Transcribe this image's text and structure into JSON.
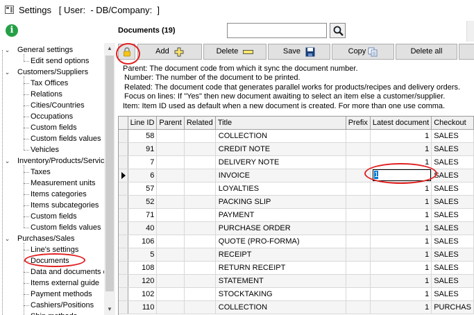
{
  "window": {
    "title": "Settings   [ User:  - DB/Company:  ]"
  },
  "tree": {
    "groups": [
      {
        "label": "General settings",
        "items": [
          "Edit send options"
        ]
      },
      {
        "label": "Customers/Suppliers",
        "items": [
          "Tax Offices",
          "Relations",
          "Cities/Countries",
          "Occupations",
          "Custom fields",
          "Custom fields values",
          "Vehicles"
        ]
      },
      {
        "label": "Inventory/Products/Servic",
        "items": [
          "Taxes",
          "Measurement units",
          "Items categories",
          "Items subcategories",
          "Custom fields",
          "Custom fields values"
        ]
      },
      {
        "label": "Purchases/Sales",
        "items": [
          "Line's settings",
          "Documents",
          "Data and documents c",
          "Items external guide",
          "Payment methods",
          "Cashiers/Positions",
          "Ship methods"
        ]
      }
    ]
  },
  "main": {
    "title": "Documents (19)",
    "search": {
      "value": "",
      "placeholder": ""
    },
    "toolbar": {
      "add": "Add",
      "delete": "Delete",
      "save": "Save",
      "copy": "Copy",
      "delete_all": "Delete all"
    },
    "notes": [
      "Parent: The document code from which it sync the document number.",
      "Number: The number of the document to be printed.",
      "Related: The document code that generates parallel works for products/recipes and delivery orders.",
      "Focus on lines: If \"Yes\" then new document awaiting to select an item else a customer/supplier.",
      "Item: Item ID used as default when a new document is created. For more than one use comma."
    ]
  },
  "grid": {
    "columns": [
      "Line ID",
      "Parent",
      "Related",
      "Title",
      "Prefix",
      "Latest document",
      "Checkout"
    ],
    "rows": [
      {
        "id": "58",
        "parent": "",
        "related": "",
        "title": "COLLECTION",
        "prefix": "",
        "latest": "1",
        "checkout": "SALES"
      },
      {
        "id": "91",
        "parent": "",
        "related": "",
        "title": "CREDIT NOTE",
        "prefix": "",
        "latest": "1",
        "checkout": "SALES"
      },
      {
        "id": "7",
        "parent": "",
        "related": "",
        "title": "DELIVERY NOTE",
        "prefix": "",
        "latest": "1",
        "checkout": "SALES"
      },
      {
        "id": "6",
        "parent": "",
        "related": "",
        "title": "INVOICE",
        "prefix": "",
        "latest": "1",
        "checkout": "SALES"
      },
      {
        "id": "57",
        "parent": "",
        "related": "",
        "title": "LOYALTIES",
        "prefix": "",
        "latest": "1",
        "checkout": "SALES"
      },
      {
        "id": "52",
        "parent": "",
        "related": "",
        "title": "PACKING SLIP",
        "prefix": "",
        "latest": "1",
        "checkout": "SALES"
      },
      {
        "id": "71",
        "parent": "",
        "related": "",
        "title": "PAYMENT",
        "prefix": "",
        "latest": "1",
        "checkout": "SALES"
      },
      {
        "id": "40",
        "parent": "",
        "related": "",
        "title": "PURCHASE ORDER",
        "prefix": "",
        "latest": "1",
        "checkout": "SALES"
      },
      {
        "id": "106",
        "parent": "",
        "related": "",
        "title": "QUOTE (PRO-FORMA)",
        "prefix": "",
        "latest": "1",
        "checkout": "SALES"
      },
      {
        "id": "5",
        "parent": "",
        "related": "",
        "title": "RECEIPT",
        "prefix": "",
        "latest": "1",
        "checkout": "SALES"
      },
      {
        "id": "108",
        "parent": "",
        "related": "",
        "title": "RETURN RECEIPT",
        "prefix": "",
        "latest": "1",
        "checkout": "SALES"
      },
      {
        "id": "120",
        "parent": "",
        "related": "",
        "title": "STATEMENT",
        "prefix": "",
        "latest": "1",
        "checkout": "SALES"
      },
      {
        "id": "102",
        "parent": "",
        "related": "",
        "title": "STOCKTAKING",
        "prefix": "",
        "latest": "1",
        "checkout": "SALES"
      },
      {
        "id": "110",
        "parent": "",
        "related": "",
        "title": "COLLECTION",
        "prefix": "",
        "latest": "1",
        "checkout": "PURCHAS"
      }
    ],
    "current_row_index": 3,
    "editing_value": "1"
  }
}
